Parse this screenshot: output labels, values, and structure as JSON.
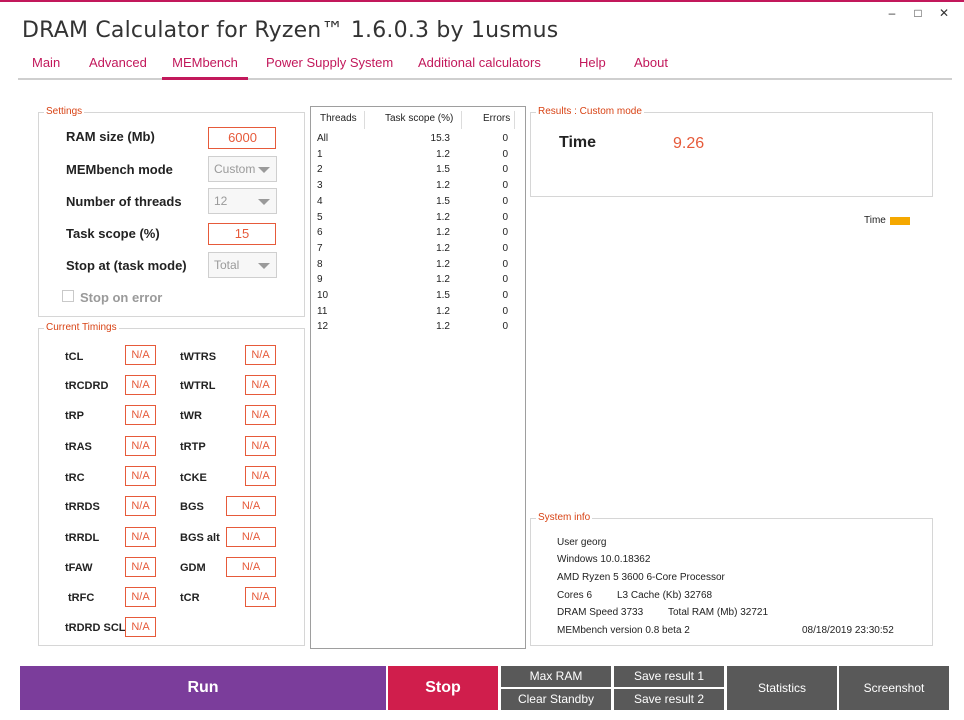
{
  "window": {
    "title": "DRAM Calculator for Ryzen™ 1.6.0.3 by 1usmus",
    "controls": {
      "minimize": "–",
      "maximize": "□",
      "close": "✕"
    }
  },
  "tabs": [
    {
      "label": "Main"
    },
    {
      "label": "Advanced"
    },
    {
      "label": "MEMbench",
      "active": true
    },
    {
      "label": "Power Supply System"
    },
    {
      "label": "Additional calculators"
    },
    {
      "label": "Help"
    },
    {
      "label": "About"
    }
  ],
  "settings": {
    "title": "Settings",
    "ram_size_label": "RAM size (Mb)",
    "ram_size_value": "6000",
    "mode_label": "MEMbench mode",
    "mode_value": "Custom",
    "threads_label": "Number of threads",
    "threads_value": "12",
    "task_scope_label": "Task scope (%)",
    "task_scope_value": "15",
    "stop_at_label": "Stop at (task mode)",
    "stop_at_value": "Total",
    "stop_on_error_label": "Stop on error",
    "stop_on_error_checked": false
  },
  "timings": {
    "title": "Current Timings",
    "items": [
      {
        "label": "tCL",
        "value": "N/A"
      },
      {
        "label": "tWTRS",
        "value": "N/A"
      },
      {
        "label": "tRCDRD",
        "value": "N/A"
      },
      {
        "label": "tWTRL",
        "value": "N/A"
      },
      {
        "label": "tRP",
        "value": "N/A"
      },
      {
        "label": "tWR",
        "value": "N/A"
      },
      {
        "label": "tRAS",
        "value": "N/A"
      },
      {
        "label": "tRTP",
        "value": "N/A"
      },
      {
        "label": "tRC",
        "value": "N/A"
      },
      {
        "label": "tCKE",
        "value": "N/A"
      },
      {
        "label": "tRRDS",
        "value": "N/A"
      },
      {
        "label": "BGS",
        "value": "N/A"
      },
      {
        "label": "tRRDL",
        "value": "N/A"
      },
      {
        "label": "BGS alt",
        "value": "N/A"
      },
      {
        "label": "tFAW",
        "value": "N/A"
      },
      {
        "label": "GDM",
        "value": "N/A"
      },
      {
        "label": "tRFC",
        "value": "N/A"
      },
      {
        "label": "tCR",
        "value": "N/A"
      },
      {
        "label": "tRDRD SCL",
        "value": "N/A"
      }
    ]
  },
  "thread_table": {
    "columns": [
      "Threads",
      "Task scope (%)",
      "Errors"
    ],
    "rows": [
      [
        "All",
        "15.3",
        "0"
      ],
      [
        "1",
        "1.2",
        "0"
      ],
      [
        "2",
        "1.5",
        "0"
      ],
      [
        "3",
        "1.2",
        "0"
      ],
      [
        "4",
        "1.5",
        "0"
      ],
      [
        "5",
        "1.2",
        "0"
      ],
      [
        "6",
        "1.2",
        "0"
      ],
      [
        "7",
        "1.2",
        "0"
      ],
      [
        "8",
        "1.2",
        "0"
      ],
      [
        "9",
        "1.2",
        "0"
      ],
      [
        "10",
        "1.5",
        "0"
      ],
      [
        "11",
        "1.2",
        "0"
      ],
      [
        "12",
        "1.2",
        "0"
      ]
    ]
  },
  "results": {
    "title": "Results : Custom mode",
    "time_label": "Time",
    "time_value": "9.26",
    "legend_label": "Time",
    "legend_color": "#f5a800"
  },
  "system_info": {
    "title": "System info",
    "user": "User georg",
    "os": "Windows 10.0.18362",
    "cpu": "AMD Ryzen 5 3600 6-Core Processor",
    "cores": "Cores 6",
    "l3_cache": "L3 Cache (Kb)  32768",
    "dram_speed": "DRAM Speed 3733",
    "total_ram": "Total RAM (Mb)  32721",
    "version": "MEMbench version 0.8 beta 2",
    "datetime": "08/18/2019 23:30:52"
  },
  "buttons": {
    "run": "Run",
    "stop": "Stop",
    "max_ram": "Max RAM",
    "clear_standby": "Clear Standby",
    "save_result_1": "Save result 1",
    "save_result_2": "Save result 2",
    "statistics": "Statistics",
    "screenshot": "Screenshot"
  },
  "colors": {
    "accent": "#c2185b",
    "value": "#e65a3a",
    "run": "#7b3d9b",
    "stop": "#d01e4c",
    "gray_button": "#595959"
  }
}
